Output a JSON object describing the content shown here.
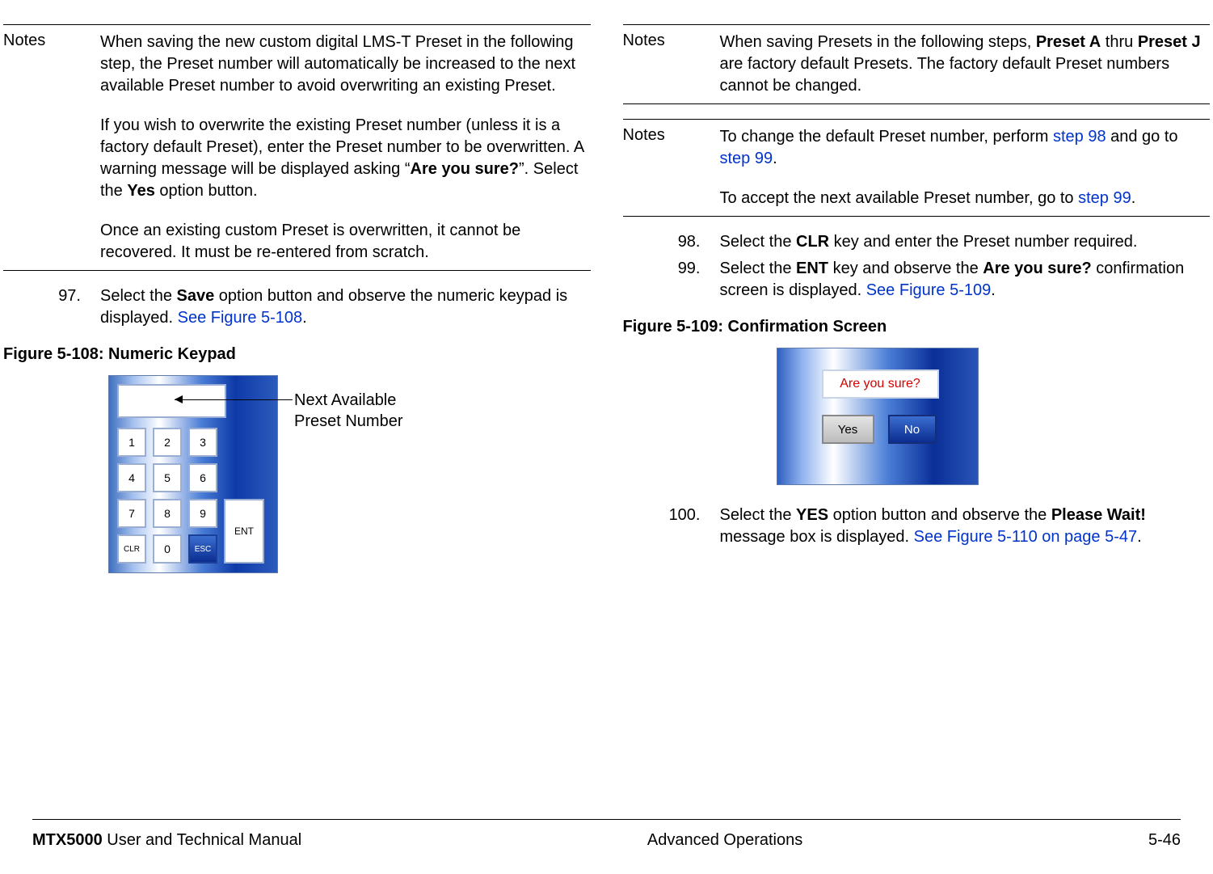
{
  "leftColumn": {
    "note1": {
      "label": "Notes",
      "p1a": "When saving the new custom digital LMS-T Preset in the following step, the Preset number will automatically be increased to the next available Preset number to avoid overwriting an existing Preset.",
      "p2a": "If you wish to overwrite the existing Preset number (unless it is a factory default Preset), enter the Preset number to be overwritten.  A warning message will be displayed asking “",
      "p2b": "Are you sure?",
      "p2c": "”.  Select the ",
      "p2d": "Yes",
      "p2e": " option button.",
      "p3a": "Once an existing custom Preset is overwritten, it cannot be recovered.  It must be re-entered from scratch."
    },
    "step97": {
      "num": "97.",
      "t1": "Select the ",
      "b1": "Save",
      "t2": " option button and observe the numeric keypad is displayed.  ",
      "xref": "See Figure 5-108",
      "t3": "."
    },
    "fig108Title": "Figure 5-108:   Numeric Keypad",
    "keypad": {
      "k1": "1",
      "k2": "2",
      "k3": "3",
      "k4": "4",
      "k5": "5",
      "k6": "6",
      "k7": "7",
      "k8": "8",
      "k9": "9",
      "k0": "0",
      "clr": "CLR",
      "esc": "ESC",
      "ent": "ENT"
    },
    "calloutL1": "Next Available",
    "calloutL2": "Preset Number"
  },
  "rightColumn": {
    "note2": {
      "label": "Notes",
      "t1": "When saving Presets in the following steps, ",
      "b1": "Preset A",
      "t2": " thru ",
      "b2": "Preset J",
      "t3": " are factory default Presets.  The factory default Preset numbers cannot be changed."
    },
    "note3": {
      "label": "Notes",
      "t1": "To change the default Preset number, perform ",
      "x1": "step 98",
      "t2": " and go to ",
      "x2": "step 99",
      "t3": ".",
      "p2t1": "To accept the next available Preset number, go to ",
      "p2x1": "step 99",
      "p2t2": "."
    },
    "step98": {
      "num": "98.",
      "t1": "Select the ",
      "b1": "CLR",
      "t2": " key and enter the Preset number required."
    },
    "step99": {
      "num": "99.",
      "t1": "Select the ",
      "b1": "ENT",
      "t2": " key and observe the ",
      "b2": "Are you sure?",
      "t3": " confirmation screen is displayed.  ",
      "xref": "See Figure 5-109",
      "t4": "."
    },
    "fig109Title": "Figure 5-109:   Confirmation Screen",
    "confirm": {
      "msg": "Are you sure?",
      "yes": "Yes",
      "no": "No"
    },
    "step100": {
      "num": "100.",
      "t1": "Select the ",
      "b1": "YES",
      "t2": " option button and observe the ",
      "b2": "Please Wait!",
      "t3": " message box is displayed.  ",
      "xref": "See Figure 5-110 on page 5-47",
      "t4": "."
    }
  },
  "footer": {
    "leftB": "MTX5000",
    "leftT": " User and Technical Manual",
    "center": "Advanced Operations",
    "right": "5-46"
  }
}
